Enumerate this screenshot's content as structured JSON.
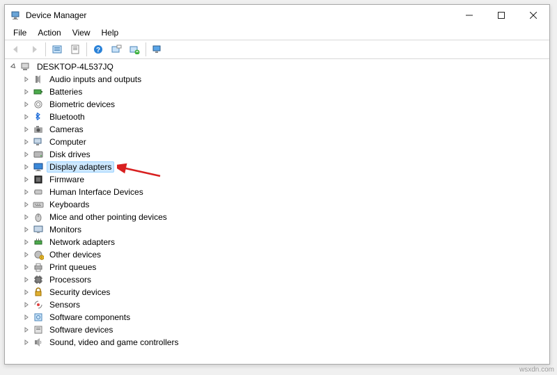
{
  "window": {
    "title": "Device Manager"
  },
  "menu": {
    "file": "File",
    "action": "Action",
    "view": "View",
    "help": "Help"
  },
  "toolbar": {
    "back": "Back",
    "forward": "Forward",
    "show_hidden": "Show hidden devices",
    "properties": "Properties",
    "help": "Help",
    "update": "Update driver",
    "uninstall": "Uninstall device",
    "scan": "Scan for hardware changes"
  },
  "tree": {
    "root": "DESKTOP-4L537JQ",
    "items": [
      {
        "label": "Audio inputs and outputs",
        "icon": "audio"
      },
      {
        "label": "Batteries",
        "icon": "battery"
      },
      {
        "label": "Biometric devices",
        "icon": "biometric"
      },
      {
        "label": "Bluetooth",
        "icon": "bluetooth"
      },
      {
        "label": "Cameras",
        "icon": "camera"
      },
      {
        "label": "Computer",
        "icon": "computer"
      },
      {
        "label": "Disk drives",
        "icon": "disk"
      },
      {
        "label": "Display adapters",
        "icon": "display",
        "selected": true
      },
      {
        "label": "Firmware",
        "icon": "firmware"
      },
      {
        "label": "Human Interface Devices",
        "icon": "hid"
      },
      {
        "label": "Keyboards",
        "icon": "keyboard"
      },
      {
        "label": "Mice and other pointing devices",
        "icon": "mouse"
      },
      {
        "label": "Monitors",
        "icon": "monitor"
      },
      {
        "label": "Network adapters",
        "icon": "network"
      },
      {
        "label": "Other devices",
        "icon": "other"
      },
      {
        "label": "Print queues",
        "icon": "printer"
      },
      {
        "label": "Processors",
        "icon": "processor"
      },
      {
        "label": "Security devices",
        "icon": "security"
      },
      {
        "label": "Sensors",
        "icon": "sensor"
      },
      {
        "label": "Software components",
        "icon": "software"
      },
      {
        "label": "Software devices",
        "icon": "software2"
      },
      {
        "label": "Sound, video and game controllers",
        "icon": "sound"
      }
    ]
  },
  "watermark": "wsxdn.com"
}
